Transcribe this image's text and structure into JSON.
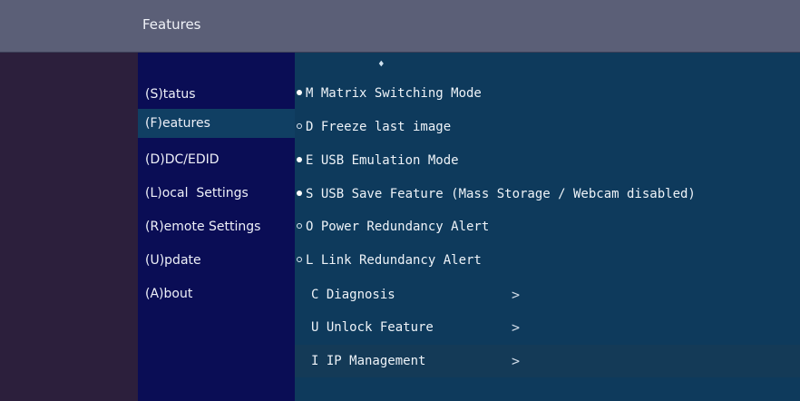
{
  "header": {
    "title": "Features"
  },
  "nav": {
    "items": [
      {
        "label": "(S)tatus"
      },
      {
        "label": "(F)eatures",
        "active": true
      },
      {
        "label": "(D)DC/EDID"
      },
      {
        "label": "(L)ocal  Settings"
      },
      {
        "label": "(R)emote Settings"
      },
      {
        "label": "(U)pdate"
      },
      {
        "label": "(A)bout"
      }
    ]
  },
  "main": {
    "scroll_up_icon": "scroll-up-indicator",
    "rows": [
      {
        "text": "M Matrix Switching Mode",
        "state": "on"
      },
      {
        "text": "D Freeze last image",
        "state": "off"
      },
      {
        "text": "E USB Emulation Mode",
        "state": "on"
      },
      {
        "text": "S USB Save Feature (Mass Storage / Webcam disabled)",
        "state": "on"
      },
      {
        "text": "O Power Redundancy Alert",
        "state": "off"
      },
      {
        "text": "L Link Redundancy Alert",
        "state": "off"
      }
    ],
    "submenus": [
      {
        "text": "C Diagnosis",
        "chevron": ">"
      },
      {
        "text": "U Unlock Feature",
        "chevron": ">"
      },
      {
        "text": "I IP Management",
        "chevron": ">",
        "selected": true
      }
    ]
  },
  "colors": {
    "titlebar": "#5b5f77",
    "nav_bg": "#0a0d55",
    "nav_active": "#103f63",
    "main_bg": "#0e3a5c",
    "left_pad": "#2c1f3c"
  }
}
